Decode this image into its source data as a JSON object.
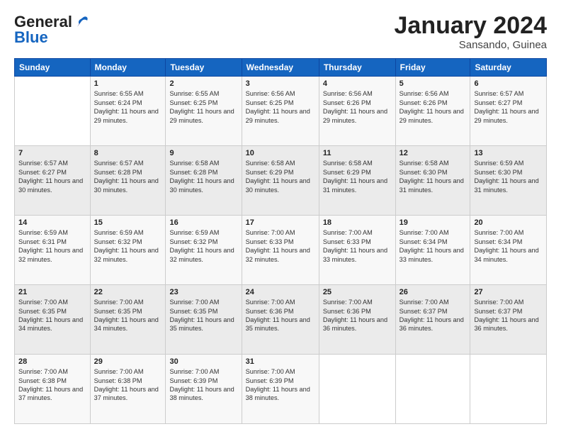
{
  "logo": {
    "general": "General",
    "blue": "Blue"
  },
  "header": {
    "title": "January 2024",
    "subtitle": "Sansando, Guinea"
  },
  "days": [
    "Sunday",
    "Monday",
    "Tuesday",
    "Wednesday",
    "Thursday",
    "Friday",
    "Saturday"
  ],
  "weeks": [
    [
      {
        "day": "",
        "sunrise": "",
        "sunset": "",
        "daylight": ""
      },
      {
        "day": "1",
        "sunrise": "Sunrise: 6:55 AM",
        "sunset": "Sunset: 6:24 PM",
        "daylight": "Daylight: 11 hours and 29 minutes."
      },
      {
        "day": "2",
        "sunrise": "Sunrise: 6:55 AM",
        "sunset": "Sunset: 6:25 PM",
        "daylight": "Daylight: 11 hours and 29 minutes."
      },
      {
        "day": "3",
        "sunrise": "Sunrise: 6:56 AM",
        "sunset": "Sunset: 6:25 PM",
        "daylight": "Daylight: 11 hours and 29 minutes."
      },
      {
        "day": "4",
        "sunrise": "Sunrise: 6:56 AM",
        "sunset": "Sunset: 6:26 PM",
        "daylight": "Daylight: 11 hours and 29 minutes."
      },
      {
        "day": "5",
        "sunrise": "Sunrise: 6:56 AM",
        "sunset": "Sunset: 6:26 PM",
        "daylight": "Daylight: 11 hours and 29 minutes."
      },
      {
        "day": "6",
        "sunrise": "Sunrise: 6:57 AM",
        "sunset": "Sunset: 6:27 PM",
        "daylight": "Daylight: 11 hours and 29 minutes."
      }
    ],
    [
      {
        "day": "7",
        "sunrise": "Sunrise: 6:57 AM",
        "sunset": "Sunset: 6:27 PM",
        "daylight": "Daylight: 11 hours and 30 minutes."
      },
      {
        "day": "8",
        "sunrise": "Sunrise: 6:57 AM",
        "sunset": "Sunset: 6:28 PM",
        "daylight": "Daylight: 11 hours and 30 minutes."
      },
      {
        "day": "9",
        "sunrise": "Sunrise: 6:58 AM",
        "sunset": "Sunset: 6:28 PM",
        "daylight": "Daylight: 11 hours and 30 minutes."
      },
      {
        "day": "10",
        "sunrise": "Sunrise: 6:58 AM",
        "sunset": "Sunset: 6:29 PM",
        "daylight": "Daylight: 11 hours and 30 minutes."
      },
      {
        "day": "11",
        "sunrise": "Sunrise: 6:58 AM",
        "sunset": "Sunset: 6:29 PM",
        "daylight": "Daylight: 11 hours and 31 minutes."
      },
      {
        "day": "12",
        "sunrise": "Sunrise: 6:58 AM",
        "sunset": "Sunset: 6:30 PM",
        "daylight": "Daylight: 11 hours and 31 minutes."
      },
      {
        "day": "13",
        "sunrise": "Sunrise: 6:59 AM",
        "sunset": "Sunset: 6:30 PM",
        "daylight": "Daylight: 11 hours and 31 minutes."
      }
    ],
    [
      {
        "day": "14",
        "sunrise": "Sunrise: 6:59 AM",
        "sunset": "Sunset: 6:31 PM",
        "daylight": "Daylight: 11 hours and 32 minutes."
      },
      {
        "day": "15",
        "sunrise": "Sunrise: 6:59 AM",
        "sunset": "Sunset: 6:32 PM",
        "daylight": "Daylight: 11 hours and 32 minutes."
      },
      {
        "day": "16",
        "sunrise": "Sunrise: 6:59 AM",
        "sunset": "Sunset: 6:32 PM",
        "daylight": "Daylight: 11 hours and 32 minutes."
      },
      {
        "day": "17",
        "sunrise": "Sunrise: 7:00 AM",
        "sunset": "Sunset: 6:33 PM",
        "daylight": "Daylight: 11 hours and 32 minutes."
      },
      {
        "day": "18",
        "sunrise": "Sunrise: 7:00 AM",
        "sunset": "Sunset: 6:33 PM",
        "daylight": "Daylight: 11 hours and 33 minutes."
      },
      {
        "day": "19",
        "sunrise": "Sunrise: 7:00 AM",
        "sunset": "Sunset: 6:34 PM",
        "daylight": "Daylight: 11 hours and 33 minutes."
      },
      {
        "day": "20",
        "sunrise": "Sunrise: 7:00 AM",
        "sunset": "Sunset: 6:34 PM",
        "daylight": "Daylight: 11 hours and 34 minutes."
      }
    ],
    [
      {
        "day": "21",
        "sunrise": "Sunrise: 7:00 AM",
        "sunset": "Sunset: 6:35 PM",
        "daylight": "Daylight: 11 hours and 34 minutes."
      },
      {
        "day": "22",
        "sunrise": "Sunrise: 7:00 AM",
        "sunset": "Sunset: 6:35 PM",
        "daylight": "Daylight: 11 hours and 34 minutes."
      },
      {
        "day": "23",
        "sunrise": "Sunrise: 7:00 AM",
        "sunset": "Sunset: 6:35 PM",
        "daylight": "Daylight: 11 hours and 35 minutes."
      },
      {
        "day": "24",
        "sunrise": "Sunrise: 7:00 AM",
        "sunset": "Sunset: 6:36 PM",
        "daylight": "Daylight: 11 hours and 35 minutes."
      },
      {
        "day": "25",
        "sunrise": "Sunrise: 7:00 AM",
        "sunset": "Sunset: 6:36 PM",
        "daylight": "Daylight: 11 hours and 36 minutes."
      },
      {
        "day": "26",
        "sunrise": "Sunrise: 7:00 AM",
        "sunset": "Sunset: 6:37 PM",
        "daylight": "Daylight: 11 hours and 36 minutes."
      },
      {
        "day": "27",
        "sunrise": "Sunrise: 7:00 AM",
        "sunset": "Sunset: 6:37 PM",
        "daylight": "Daylight: 11 hours and 36 minutes."
      }
    ],
    [
      {
        "day": "28",
        "sunrise": "Sunrise: 7:00 AM",
        "sunset": "Sunset: 6:38 PM",
        "daylight": "Daylight: 11 hours and 37 minutes."
      },
      {
        "day": "29",
        "sunrise": "Sunrise: 7:00 AM",
        "sunset": "Sunset: 6:38 PM",
        "daylight": "Daylight: 11 hours and 37 minutes."
      },
      {
        "day": "30",
        "sunrise": "Sunrise: 7:00 AM",
        "sunset": "Sunset: 6:39 PM",
        "daylight": "Daylight: 11 hours and 38 minutes."
      },
      {
        "day": "31",
        "sunrise": "Sunrise: 7:00 AM",
        "sunset": "Sunset: 6:39 PM",
        "daylight": "Daylight: 11 hours and 38 minutes."
      },
      {
        "day": "",
        "sunrise": "",
        "sunset": "",
        "daylight": ""
      },
      {
        "day": "",
        "sunrise": "",
        "sunset": "",
        "daylight": ""
      },
      {
        "day": "",
        "sunrise": "",
        "sunset": "",
        "daylight": ""
      }
    ]
  ]
}
